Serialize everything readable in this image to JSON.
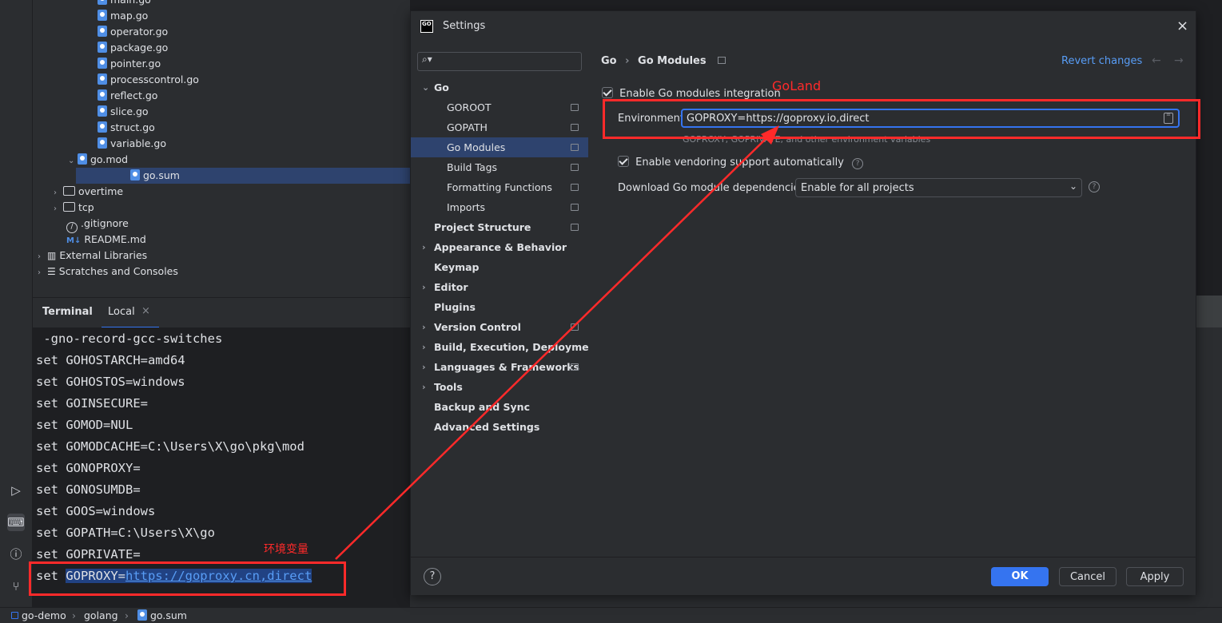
{
  "tree": {
    "files": [
      "main.go",
      "map.go",
      "operator.go",
      "package.go",
      "pointer.go",
      "processcontrol.go",
      "reflect.go",
      "slice.go",
      "struct.go",
      "variable.go"
    ],
    "gomod": "go.mod",
    "gosum": "go.sum",
    "folders": [
      "overtime",
      "tcp"
    ],
    "gitignore": ".gitignore",
    "readme": "README.md",
    "readme_badge": "M↓",
    "external": "External Libraries",
    "scratches": "Scratches and Consoles"
  },
  "terminal": {
    "tab_title": "Terminal",
    "tab_local": "Local",
    "lines": [
      " -gno-record-gcc-switches",
      "set GOHOSTARCH=amd64",
      "set GOHOSTOS=windows",
      "set GOINSECURE=",
      "set GOMOD=NUL",
      "set GOMODCACHE=C:\\Users\\X\\go\\pkg\\mod",
      "set GONOPROXY=",
      "set GONOSUMDB=",
      "set GOOS=windows",
      "set GOPATH=C:\\Users\\X\\go",
      "set GOPRIVATE="
    ],
    "last_prefix": "set ",
    "last_key": "GOPROXY=",
    "last_link": "https://goproxy.cn,direct"
  },
  "annotations": {
    "env_label": "环境变量",
    "goland_label": "GoLand"
  },
  "statusbar": {
    "crumbs": [
      "go-demo",
      "golang",
      "go.sum"
    ]
  },
  "dialog": {
    "title": "Settings",
    "search_placeholder": "",
    "sidebar": [
      {
        "label": "Go",
        "bold": true,
        "chev": "down",
        "indent": 0
      },
      {
        "label": "GOROOT",
        "bold": false,
        "pin": true,
        "indent": 1
      },
      {
        "label": "GOPATH",
        "bold": false,
        "pin": true,
        "indent": 1
      },
      {
        "label": "Go Modules",
        "bold": false,
        "pin": true,
        "indent": 1,
        "selected": true
      },
      {
        "label": "Build Tags",
        "bold": false,
        "pin": true,
        "indent": 1
      },
      {
        "label": "Formatting Functions",
        "bold": false,
        "pin": true,
        "indent": 1
      },
      {
        "label": "Imports",
        "bold": false,
        "pin": true,
        "indent": 1
      },
      {
        "label": "Project Structure",
        "bold": true,
        "pin": true,
        "indent": 0
      },
      {
        "label": "Appearance & Behavior",
        "bold": true,
        "chev": "right",
        "indent": 0
      },
      {
        "label": "Keymap",
        "bold": true,
        "indent": 0
      },
      {
        "label": "Editor",
        "bold": true,
        "chev": "right",
        "indent": 0
      },
      {
        "label": "Plugins",
        "bold": true,
        "indent": 0
      },
      {
        "label": "Version Control",
        "bold": true,
        "chev": "right",
        "pin": true,
        "indent": 0
      },
      {
        "label": "Build, Execution, Deployment",
        "bold": true,
        "chev": "right",
        "indent": 0
      },
      {
        "label": "Languages & Frameworks",
        "bold": true,
        "chev": "right",
        "pin": true,
        "indent": 0
      },
      {
        "label": "Tools",
        "bold": true,
        "chev": "right",
        "indent": 0
      },
      {
        "label": "Backup and Sync",
        "bold": true,
        "indent": 0
      },
      {
        "label": "Advanced Settings",
        "bold": true,
        "indent": 0
      }
    ],
    "breadcrumb": [
      "Go",
      "Go Modules"
    ],
    "revert": "Revert changes",
    "enable_modules": "Enable Go modules integration",
    "env_label": "Environment:",
    "env_value": "GOPROXY=https://goproxy.io,direct",
    "env_hint": "GOPROXY, GOPRIVATE, and other environment variables",
    "vendoring": "Enable vendoring support automatically",
    "download_label": "Download Go module dependencies:",
    "download_value": "Enable for all projects",
    "ok": "OK",
    "cancel": "Cancel",
    "apply": "Apply",
    "help": "?"
  },
  "colors": {
    "accent": "#3574f0",
    "selection": "#2e436e",
    "annotation": "#ff2a2a",
    "link": "#589df6"
  }
}
